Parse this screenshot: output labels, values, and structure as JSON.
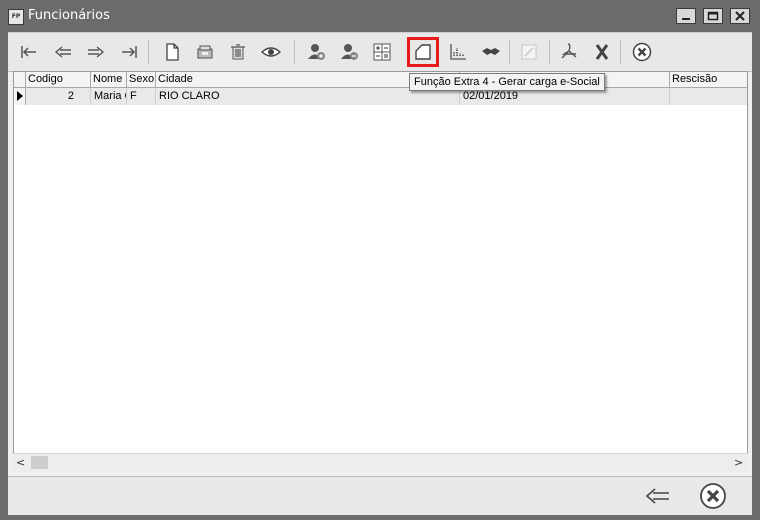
{
  "window": {
    "title": "Funcionários",
    "app_icon_text": "FP"
  },
  "toolbar": {
    "buttons": [
      {
        "name": "first-record-icon"
      },
      {
        "name": "previous-record-icon"
      },
      {
        "name": "next-record-icon"
      },
      {
        "name": "last-record-icon"
      },
      {
        "name": "new-record-icon"
      },
      {
        "name": "edit-record-icon"
      },
      {
        "name": "delete-icon"
      },
      {
        "name": "view-icon"
      },
      {
        "name": "add-person-icon"
      },
      {
        "name": "remove-person-icon"
      },
      {
        "name": "calculator-icon"
      },
      {
        "name": "extra-function-4-icon",
        "highlighted": true
      },
      {
        "name": "report-chart-icon"
      },
      {
        "name": "handshake-icon"
      },
      {
        "name": "disabled-edit-icon"
      },
      {
        "name": "pdf-icon"
      },
      {
        "name": "excel-icon"
      },
      {
        "name": "close-circle-icon"
      }
    ],
    "tooltip": "Função Extra 4 - Gerar carga e-Social",
    "highlight_color": "#e31b1b"
  },
  "grid": {
    "columns": [
      "Codigo",
      "Nome",
      "Sexo",
      "Cidade",
      "",
      "Rescisão"
    ],
    "rows": [
      {
        "codigo": "2",
        "nome": "Maria C",
        "sexo": "F",
        "cidade": "RIO CLARO",
        "admissao": "02/01/2019",
        "rescisao": ""
      }
    ]
  },
  "scrollbar": {
    "left_arrow": "<",
    "right_arrow": ">"
  }
}
